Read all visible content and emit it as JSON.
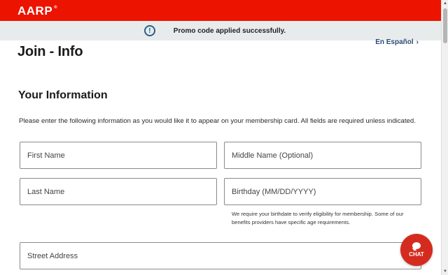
{
  "header": {
    "brand": "AARP",
    "registered_mark": "®",
    "brand_color": "#ec1300"
  },
  "promo": {
    "icon": "info-circle-icon",
    "message": "Promo code applied successfully."
  },
  "language_link": {
    "label": "En Español",
    "chevron": "›"
  },
  "page": {
    "title": "Join - Info",
    "section_title": "Your Information",
    "intro": "Please enter the following information as you would like it to appear on your membership card. All fields are required unless indicated."
  },
  "form": {
    "first_name": {
      "placeholder": "First Name",
      "value": ""
    },
    "middle_name": {
      "placeholder": "Middle Name (Optional)",
      "value": ""
    },
    "last_name": {
      "placeholder": "Last Name",
      "value": ""
    },
    "birthday": {
      "placeholder": "Birthday (MM/DD/YYYY)",
      "value": ""
    },
    "birthday_helper": "We require your birthdate to verify eligibility for membership. Some of our benefits providers have specific age requirements.",
    "street_address": {
      "placeholder": "Street Address",
      "value": ""
    }
  },
  "chat": {
    "icon": "chat-bubble-icon",
    "label": "CHAT",
    "color": "#d42b1e"
  }
}
